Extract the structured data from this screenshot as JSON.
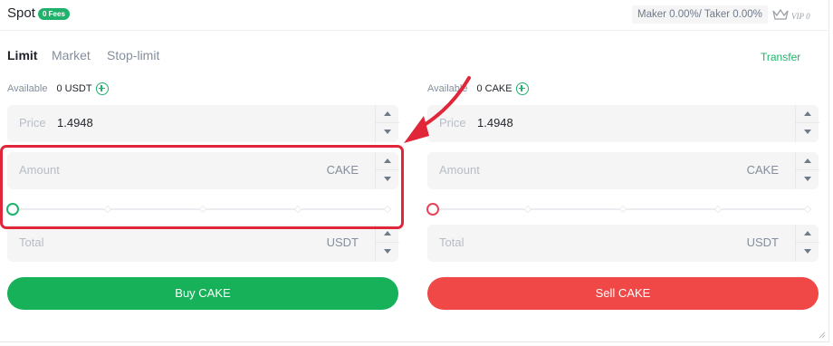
{
  "header": {
    "title": "Spot",
    "fees_badge": "0 Fees",
    "fee_info": "Maker 0.00%/ Taker 0.00%",
    "vip_label": "VIP 0"
  },
  "tabs": [
    {
      "label": "Limit",
      "active": true
    },
    {
      "label": "Market",
      "active": false
    },
    {
      "label": "Stop-limit",
      "active": false
    }
  ],
  "transfer_label": "Transfer",
  "buy": {
    "available_label": "Available",
    "available_value": "0 USDT",
    "price_label": "Price",
    "price_value": "1.4948",
    "amount_placeholder": "Amount",
    "amount_unit": "CAKE",
    "slider_percent": 0,
    "total_placeholder": "Total",
    "total_unit": "USDT",
    "button_label": "Buy CAKE"
  },
  "sell": {
    "available_label": "Available",
    "available_value": "0 CAKE",
    "price_label": "Price",
    "price_value": "1.4948",
    "amount_placeholder": "Amount",
    "amount_unit": "CAKE",
    "slider_percent": 0,
    "total_placeholder": "Total",
    "total_unit": "USDT",
    "button_label": "Sell CAKE"
  },
  "colors": {
    "buy": "#16b158",
    "sell": "#f04747",
    "accent": "#20b26c",
    "annotation": "#e2263a"
  }
}
